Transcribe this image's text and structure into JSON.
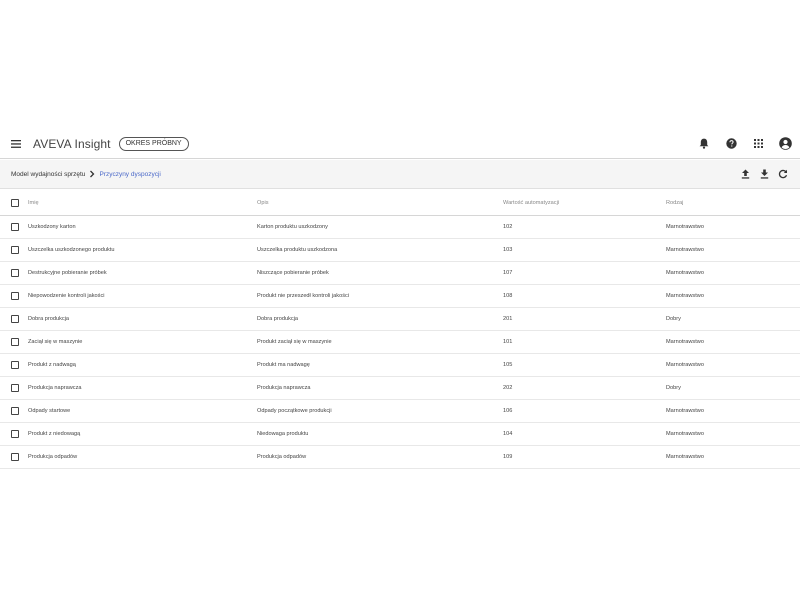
{
  "app": {
    "title": "AVEVA Insight",
    "badge": "OKRES PRÓBNY"
  },
  "header_icons": [
    "menu-icon",
    "bell-icon",
    "help-icon",
    "apps-grid-icon",
    "account-icon"
  ],
  "breadcrumb": {
    "parent": "Model wydajności sprzętu",
    "current": "Przyczyny dyspozycji"
  },
  "toolbar_icons": [
    "upload-icon",
    "download-icon",
    "refresh-icon"
  ],
  "colors": {
    "accent_link": "#4a68c8",
    "icon": "#333333",
    "toolbar_bg": "#f5f5f5"
  },
  "table": {
    "columns": [
      "Imię",
      "Opis",
      "Wartość automatyzacji",
      "Rodzaj"
    ],
    "rows": [
      {
        "name": "Uszkodzony karton",
        "desc": "Karton produktu uszkodzony",
        "value": "102",
        "type": "Marnotrawstwo"
      },
      {
        "name": "Uszczelka uszkodzonego produktu",
        "desc": "Uszczelka produktu uszkodzona",
        "value": "103",
        "type": "Marnotrawstwo"
      },
      {
        "name": "Destrukcyjne pobieranie próbek",
        "desc": "Niszczące pobieranie próbek",
        "value": "107",
        "type": "Marnotrawstwo"
      },
      {
        "name": "Niepowodzenie kontroli jakości",
        "desc": "Produkt nie przeszedł kontroli jakości",
        "value": "108",
        "type": "Marnotrawstwo"
      },
      {
        "name": "Dobra produkcja",
        "desc": "Dobra produkcja",
        "value": "201",
        "type": "Dobry"
      },
      {
        "name": "Zaciął się w maszynie",
        "desc": "Produkt zaciął się w maszynie",
        "value": "101",
        "type": "Marnotrawstwo"
      },
      {
        "name": "Produkt z nadwagą",
        "desc": "Produkt ma nadwagę",
        "value": "105",
        "type": "Marnotrawstwo"
      },
      {
        "name": "Produkcja naprawcza",
        "desc": "Produkcja naprawcza",
        "value": "202",
        "type": "Dobry"
      },
      {
        "name": "Odpady startowe",
        "desc": "Odpady początkowe produkcji",
        "value": "106",
        "type": "Marnotrawstwo"
      },
      {
        "name": "Produkt z niedowagą",
        "desc": "Niedowaga produktu",
        "value": "104",
        "type": "Marnotrawstwo"
      },
      {
        "name": "Produkcja odpadów",
        "desc": "Produkcja odpadów",
        "value": "109",
        "type": "Marnotrawstwo"
      }
    ]
  }
}
